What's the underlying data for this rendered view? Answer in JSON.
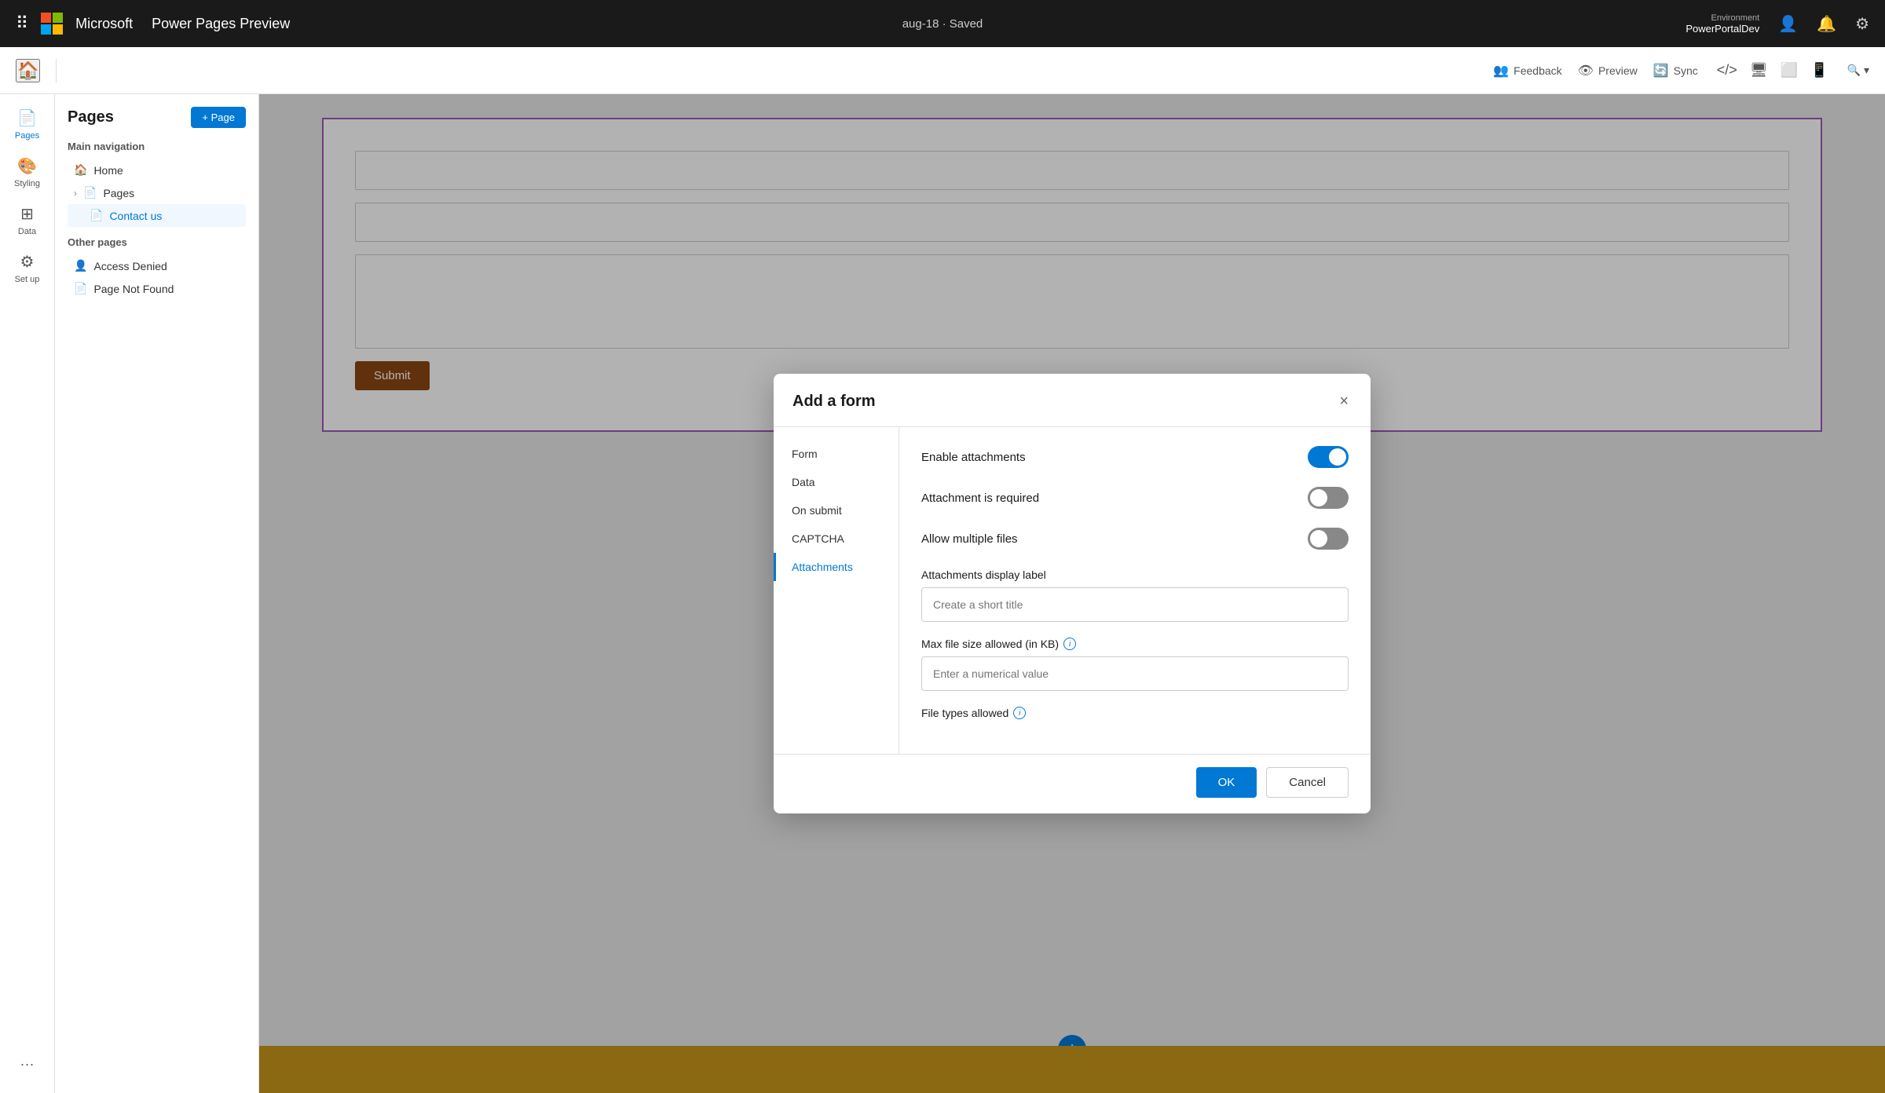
{
  "topbar": {
    "app_title": "Power Pages Preview",
    "saved_label": "aug-18 · Saved",
    "env_label": "Environment",
    "env_name": "PowerPortalDev",
    "feedback_label": "Feedback",
    "preview_label": "Preview",
    "sync_label": "Sync"
  },
  "sidebar": {
    "pages_label": "Pages",
    "styling_label": "Styling",
    "data_label": "Data",
    "setup_label": "Set up",
    "more_label": "..."
  },
  "pages_panel": {
    "title": "Pages",
    "add_page_label": "+ Page",
    "main_nav_title": "Main navigation",
    "other_pages_title": "Other pages",
    "nav_items": [
      {
        "label": "Home"
      },
      {
        "label": "Pages"
      },
      {
        "label": "Contact us"
      }
    ],
    "other_items": [
      {
        "label": "Access Denied"
      },
      {
        "label": "Page Not Found"
      }
    ]
  },
  "dialog": {
    "title": "Add a form",
    "nav_items": [
      {
        "label": "Form",
        "active": false
      },
      {
        "label": "Data",
        "active": false
      },
      {
        "label": "On submit",
        "active": false
      },
      {
        "label": "CAPTCHA",
        "active": false
      },
      {
        "label": "Attachments",
        "active": true
      }
    ],
    "toggles": [
      {
        "label": "Enable attachments",
        "state": "on"
      },
      {
        "label": "Attachment is required",
        "state": "off"
      },
      {
        "label": "Allow multiple files",
        "state": "off"
      }
    ],
    "attachments_display_label": "Attachments display label",
    "attachments_placeholder": "Create a short title",
    "max_file_size_label": "Max file size allowed (in KB)",
    "max_file_size_placeholder": "Enter a numerical value",
    "file_types_label": "File types allowed",
    "ok_label": "OK",
    "cancel_label": "Cancel",
    "close_icon": "×"
  },
  "canvas": {
    "submit_label": "Submit"
  }
}
